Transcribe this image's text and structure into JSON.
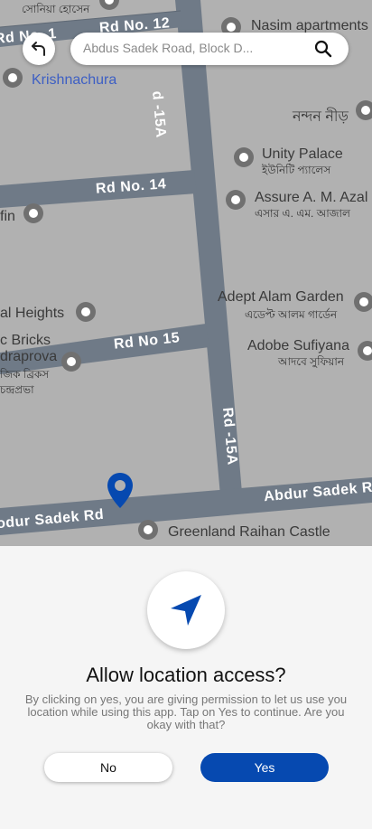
{
  "map": {
    "roads": {
      "rd_no_12": "Rd No. 12",
      "rd_no_14": "Rd No. 14",
      "rd_no_15": "Rd No 15",
      "rd_15a_top": "d -15A",
      "rd_15a_upper": "Rd -15A",
      "rd_15a_lower": "Rd -15A",
      "abdur_sadek_left": "odur Sadek Rd",
      "abdur_sadek_right": "Abdur Sadek R",
      "rd_no_1x": "Rd No. 1"
    },
    "places": {
      "top_left_bn": "সোনিয়া হোসেন",
      "nasim": "Nasim apartments",
      "krishnachura": "Krishnachura",
      "nandan_bn": "নন্দন নীড়",
      "unity_en": "Unity Palace",
      "unity_bn": "ইউনিটি প্যালেস",
      "assure_en": "Assure A. M. Azal",
      "assure_bn": "এসার এ. এম. আজাল",
      "fin": "fin",
      "al_heights": "al Heights",
      "adept_en": "Adept Alam Garden",
      "adept_bn": "এডেপ্ট আলম গার্ডেন",
      "c_bricks": "c Bricks",
      "draprova": "draprova",
      "jik_bricks_bn": "জিক ব্রিকস",
      "chandraprova_bn": "চন্দ্রপ্রভা",
      "adobe_en": "Adobe Sufiyana",
      "adobe_bn": "আদবে সুফিয়ান",
      "greenland": "Greenland Raihan Castle"
    }
  },
  "search": {
    "placeholder": "Abdus Sadek Road, Block D..."
  },
  "dialog": {
    "title": "Allow location access?",
    "description": "By clicking on yes, you are giving permission to let us use you location while using this app. Tap on Yes to continue. Are you okay with that?",
    "no_label": "No",
    "yes_label": "Yes"
  },
  "colors": {
    "accent": "#0649b0",
    "map_bg": "#b1b1b1",
    "road": "#6f7a87"
  },
  "icons": {
    "back": "back-arrow-icon",
    "search": "search-icon",
    "location": "navigation-arrow-icon",
    "marker": "location-pin-icon",
    "poi": "poi-marker-icon"
  }
}
